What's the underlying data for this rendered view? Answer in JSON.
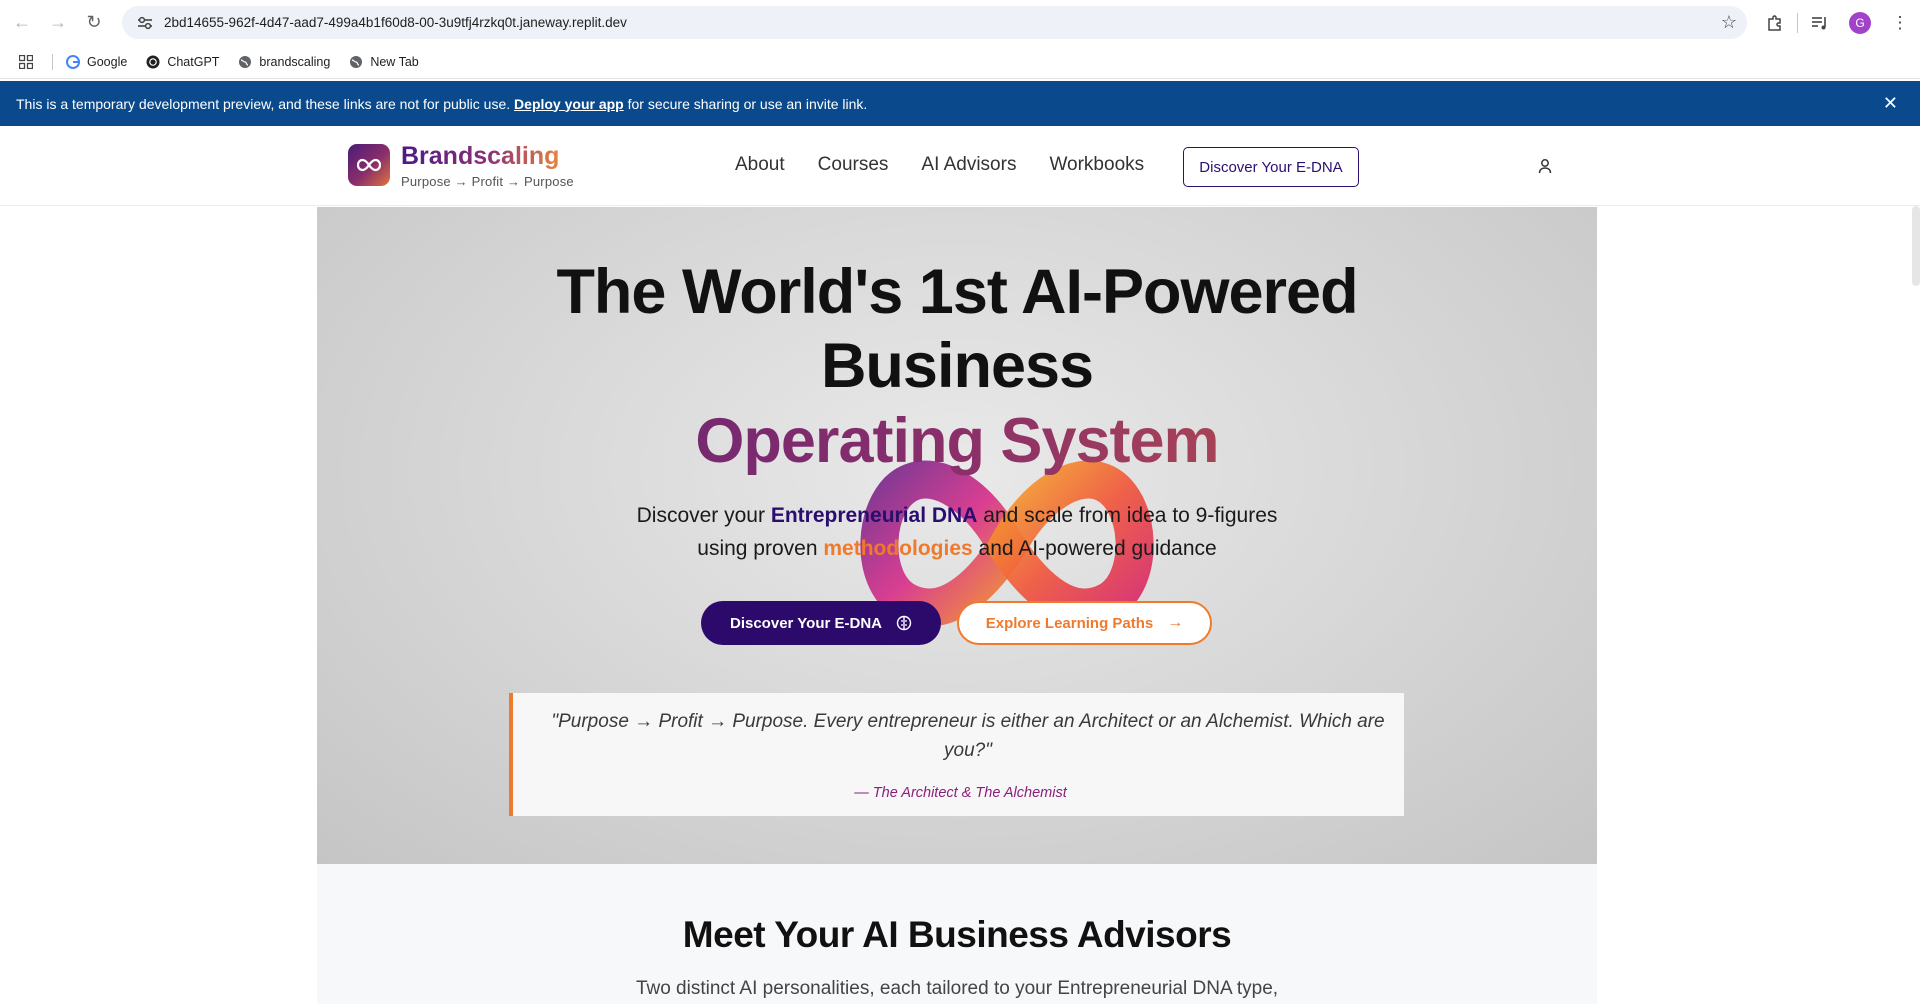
{
  "browser": {
    "url": "2bd14655-962f-4d47-aad7-499a4b1f60d8-00-3u9tfj4rzkq0t.janeway.replit.dev",
    "profile_initial": "G",
    "bookmarks": [
      {
        "label": "Google",
        "icon": "google-icon"
      },
      {
        "label": "ChatGPT",
        "icon": "chatgpt-icon"
      },
      {
        "label": "brandscaling",
        "icon": "globe-icon"
      },
      {
        "label": "New Tab",
        "icon": "globe-icon"
      }
    ]
  },
  "dev_banner": {
    "prefix": "This is a temporary development preview, and these links are not for public use.",
    "link": "Deploy your app",
    "suffix": "for secure sharing or use an invite link."
  },
  "header": {
    "brand": "Brandscaling",
    "tagline": "Purpose → Profit → Purpose",
    "nav": [
      "About",
      "Courses",
      "AI Advisors",
      "Workbooks"
    ],
    "cta": "Discover Your E-DNA"
  },
  "hero": {
    "title_line1": "The World's 1st AI-Powered",
    "title_line2": "Business",
    "title_line3": "Operating System",
    "sub_line1_a": "Discover your",
    "sub_line1_highlight": "Entrepreneurial DNA",
    "sub_line1_b": "and scale from idea to 9-figures",
    "sub_line2_a": "using proven",
    "sub_line2_highlight": "methodologies",
    "sub_line2_b": "and AI-powered guidance",
    "primary_cta": "Discover Your E-DNA",
    "secondary_cta": "Explore Learning Paths",
    "quote": "\"Purpose → Profit → Purpose. Every entrepreneur is either an Architect or an Alchemist. Which are you?\"",
    "quote_author": "— The Architect & The Alchemist"
  },
  "advisors": {
    "title": "Meet Your AI Business Advisors",
    "subtitle": "Two distinct AI personalities, each tailored to your Entrepreneurial DNA type,"
  },
  "colors": {
    "banner": "#0a4a8c",
    "brand_purple": "#2b0a6b",
    "brand_orange": "#f07a2c",
    "quote_author": "#8a1f7a"
  }
}
